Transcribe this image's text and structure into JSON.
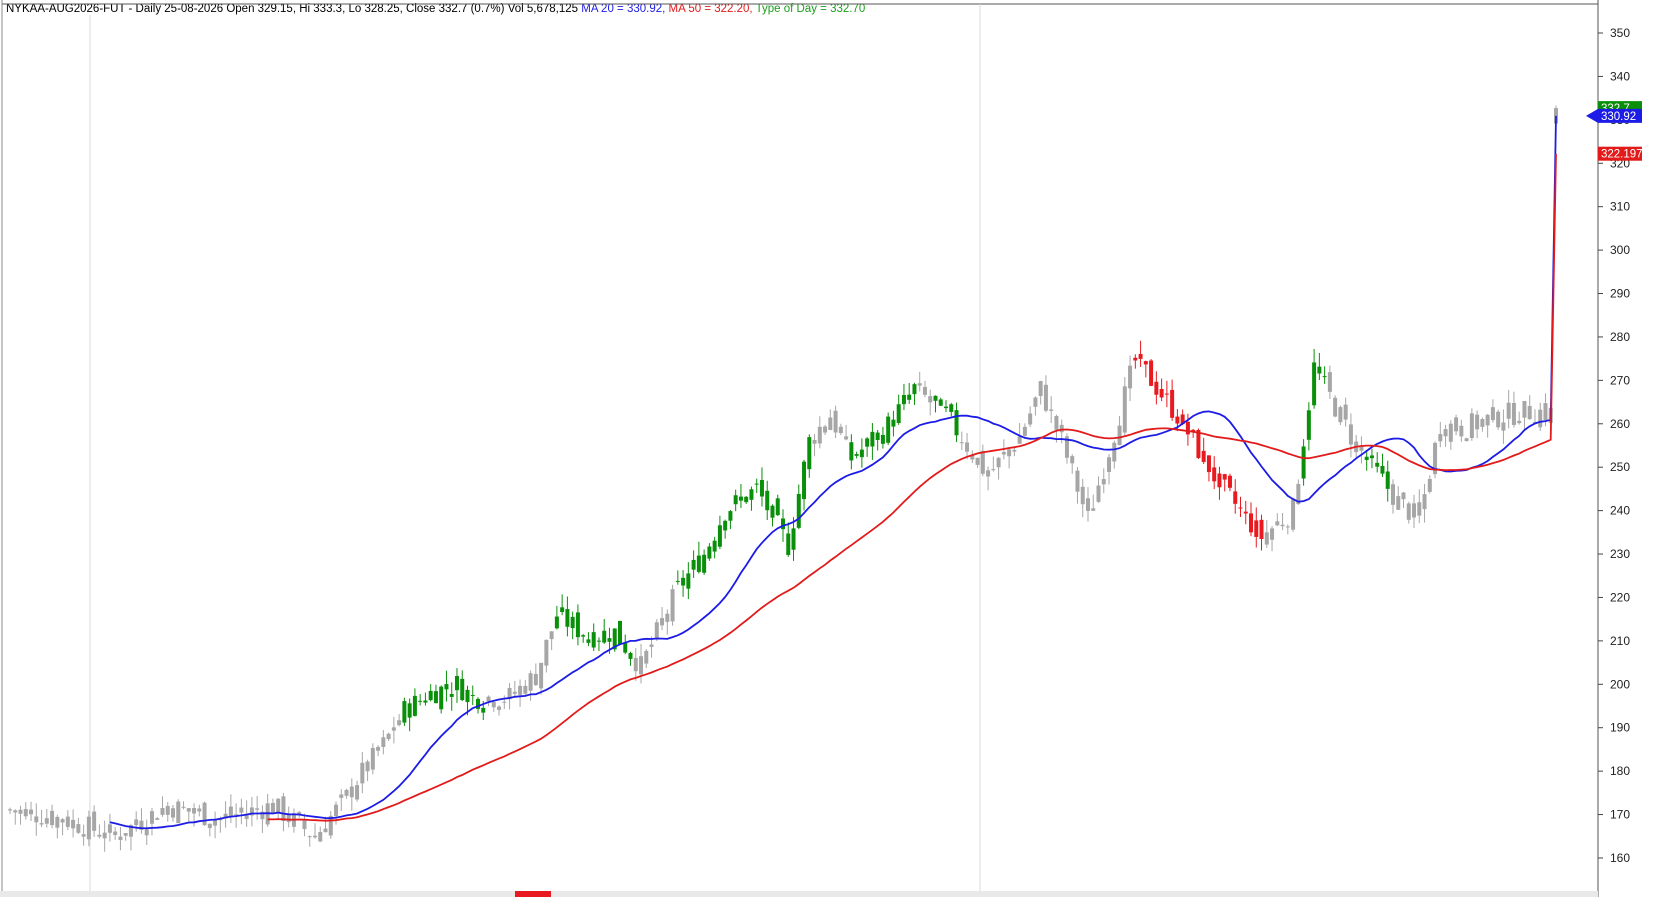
{
  "header": {
    "symbol": "NYKAA-AUG2026-FUT",
    "timeframe": "Daily 25-08-2026",
    "open_label": "Open 329.15,",
    "high_label": "Hi 333.3,",
    "low_label": "Lo 328.25,",
    "close_label": "Close 332.7 (0.7%)",
    "vol_label": "Vol 5,678,125",
    "ma20_label": "MA 20 = 330.92,",
    "ma50_label": "MA 50 = 322.20,",
    "tod_label": "Type of Day = 332.70"
  },
  "colors": {
    "background": "#ffffff",
    "bull": "#0a8f0a",
    "bear": "#e8191f",
    "neutral": "#a6a6a6",
    "ma20": "#1c1ce6",
    "ma50": "#e21a1a",
    "tod_text": "#1aa01a",
    "axis": "#444444"
  },
  "chart_data": {
    "type": "candlestick",
    "symbol": "NYKAA-AUG2026-FUT",
    "y_axis_side": "right",
    "ylim": [
      152,
      356
    ],
    "yticks": [
      160,
      170,
      180,
      190,
      200,
      210,
      220,
      230,
      240,
      250,
      260,
      270,
      280,
      290,
      300,
      310,
      320,
      330,
      340,
      350
    ],
    "grid": false,
    "bar_count": 295,
    "anchors": [
      [
        0,
        171
      ],
      [
        10,
        169
      ],
      [
        20,
        165
      ],
      [
        30,
        172
      ],
      [
        40,
        169
      ],
      [
        50,
        172
      ],
      [
        58,
        165
      ],
      [
        64,
        174
      ],
      [
        66,
        178
      ],
      [
        71,
        186
      ],
      [
        75,
        194
      ],
      [
        80,
        198
      ],
      [
        85,
        200
      ],
      [
        88,
        197
      ],
      [
        95,
        197
      ],
      [
        100,
        202
      ],
      [
        104,
        216
      ],
      [
        110,
        211
      ],
      [
        115,
        212
      ],
      [
        120,
        204
      ],
      [
        127,
        222
      ],
      [
        132,
        230
      ],
      [
        136,
        240
      ],
      [
        142,
        245
      ],
      [
        148,
        232
      ],
      [
        152,
        256
      ],
      [
        156,
        262
      ],
      [
        160,
        252
      ],
      [
        166,
        258
      ],
      [
        172,
        268
      ],
      [
        178,
        262
      ],
      [
        186,
        248
      ],
      [
        192,
        257
      ],
      [
        196,
        268
      ],
      [
        200,
        256
      ],
      [
        205,
        238
      ],
      [
        210,
        258
      ],
      [
        214,
        275
      ],
      [
        222,
        262
      ],
      [
        230,
        246
      ],
      [
        238,
        234
      ],
      [
        244,
        240
      ],
      [
        248,
        273
      ],
      [
        252,
        264
      ],
      [
        256,
        255
      ],
      [
        264,
        242
      ],
      [
        268,
        238
      ],
      [
        272,
        260
      ],
      [
        276,
        259
      ],
      [
        284,
        262
      ],
      [
        290,
        263
      ],
      [
        295,
        262
      ],
      [
        298,
        270
      ],
      [
        301,
        276
      ],
      [
        305,
        291
      ],
      [
        310,
        305
      ],
      [
        316,
        320
      ],
      [
        322,
        330
      ],
      [
        330,
        327
      ],
      [
        335,
        333
      ],
      [
        340,
        345
      ],
      [
        344,
        330
      ],
      [
        350,
        324
      ],
      [
        355,
        332
      ]
    ],
    "last_bar": {
      "open": 329.15,
      "high": 333.3,
      "low": 328.25,
      "close": 332.7
    },
    "series": [
      {
        "name": "MA 20",
        "window": 20,
        "last": 330.92,
        "tag": "330.92"
      },
      {
        "name": "MA 50",
        "window": 50,
        "last": 322.2,
        "tag": "322.197"
      },
      {
        "name": "Type of Day",
        "last": 332.7,
        "tag": "332.7"
      }
    ],
    "red_zone": [
      214,
      238
    ],
    "green_zones": [
      [
        75,
        90
      ],
      [
        104,
        118
      ],
      [
        127,
        152
      ],
      [
        160,
        172
      ],
      [
        176,
        180
      ],
      [
        246,
        250
      ],
      [
        258,
        262
      ],
      [
        305,
        355
      ]
    ]
  }
}
